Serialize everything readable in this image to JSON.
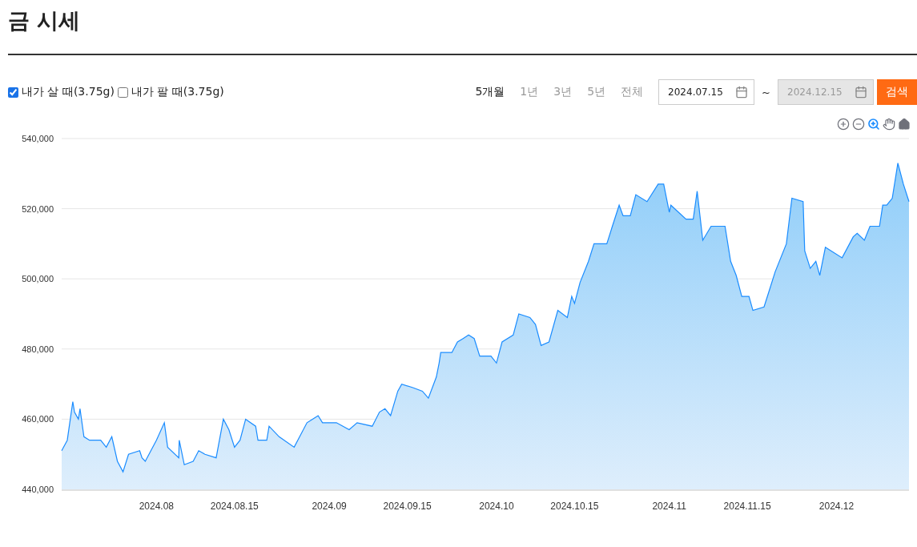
{
  "title": "금 시세",
  "options": [
    {
      "label": "내가 살 때(3.75g)",
      "checked": true
    },
    {
      "label": "내가 팔 때(3.75g)",
      "checked": false
    }
  ],
  "periods": [
    {
      "label": "5개월",
      "selected": true
    },
    {
      "label": "1년",
      "selected": false
    },
    {
      "label": "3년",
      "selected": false
    },
    {
      "label": "5년",
      "selected": false
    },
    {
      "label": "전체",
      "selected": false
    }
  ],
  "date_from": {
    "value": "2024.07.15",
    "disabled": false
  },
  "separator": "~",
  "date_to": {
    "value": "2024.12.15",
    "disabled": true
  },
  "search_button": "검색",
  "chart_tools": [
    {
      "kind": "zoom_in",
      "selected": false
    },
    {
      "kind": "zoom_out",
      "selected": false
    },
    {
      "kind": "selection_zoom",
      "selected": true
    },
    {
      "kind": "pan",
      "selected": false
    },
    {
      "kind": "reset",
      "selected": false
    }
  ],
  "chart_data": {
    "type": "area",
    "x": [
      "2024-07-15",
      "2024-07-16",
      "2024-07-17",
      "2024-07-17T07:00",
      "2024-07-18",
      "2024-07-18T07:00",
      "2024-07-19",
      "2024-07-20",
      "2024-07-22",
      "2024-07-23",
      "2024-07-24",
      "2024-07-25",
      "2024-07-26",
      "2024-07-27",
      "2024-07-29",
      "2024-07-29T10:00",
      "2024-07-30",
      "2024-07-31",
      "2024-08-01",
      "2024-08-02T10:00",
      "2024-08-03",
      "2024-08-05",
      "2024-08-05T02:00",
      "2024-08-06",
      "2024-08-07T14:00",
      "2024-08-08T14:00",
      "2024-08-09T17:00",
      "2024-08-11T17:00",
      "2024-08-13",
      "2024-08-14",
      "2024-08-15",
      "2024-08-16",
      "2024-08-17",
      "2024-08-18T19:00",
      "2024-08-19T05:00",
      "2024-08-20T19:00",
      "2024-08-21T05:00",
      "2024-08-23",
      "2024-08-25T17:00",
      "2024-08-28",
      "2024-08-29",
      "2024-08-30",
      "2024-08-30T19:00",
      "2024-09-02T07:00",
      "2024-09-04T14:00",
      "2024-09-06",
      "2024-09-08T17:00",
      "2024-09-10",
      "2024-09-11",
      "2024-09-12",
      "2024-09-13T07:00",
      "2024-09-14",
      "2024-09-16",
      "2024-09-17T17:00",
      "2024-09-18T19:00",
      "2024-09-20T05:00",
      "2024-09-20T17:00",
      "2024-09-21",
      "2024-09-23",
      "2024-09-24",
      "2024-09-25",
      "2024-09-26",
      "2024-09-27",
      "2024-09-28",
      "2024-09-30",
      "2024-10-01",
      "2024-10-02",
      "2024-10-04",
      "2024-10-05",
      "2024-10-07",
      "2024-10-08",
      "2024-10-09",
      "2024-10-10T10:00",
      "2024-10-12",
      "2024-10-13T17:00",
      "2024-10-14T12:00",
      "2024-10-15",
      "2024-10-16",
      "2024-10-17T12:00",
      "2024-10-18T12:00",
      "2024-10-20T19:00",
      "2024-10-21T19:00",
      "2024-10-23",
      "2024-10-23T17:00",
      "2024-10-25",
      "2024-10-26",
      "2024-10-28",
      "2024-10-30",
      "2024-10-31",
      "2024-11-01",
      "2024-11-01T07:00",
      "2024-11-04",
      "2024-11-05T07:00",
      "2024-11-06",
      "2024-11-07",
      "2024-11-08T12:00",
      "2024-11-11",
      "2024-11-12",
      "2024-11-13",
      "2024-11-14",
      "2024-11-15T07:00",
      "2024-11-16",
      "2024-11-18",
      "2024-11-19",
      "2024-11-20",
      "2024-11-22",
      "2024-11-23",
      "2024-11-25",
      "2024-11-25T07:00",
      "2024-11-26T07:00",
      "2024-11-27T07:00",
      "2024-11-28",
      "2024-11-29",
      "2024-12-02",
      "2024-12-04",
      "2024-12-04T17:00",
      "2024-12-06",
      "2024-12-07",
      "2024-12-08T17:00",
      "2024-12-09T07:00",
      "2024-12-10",
      "2024-12-11",
      "2024-12-12",
      "2024-12-13",
      "2024-12-14"
    ],
    "series": [
      {
        "color": "#1a8cff",
        "values": [
          451000,
          454000,
          465000,
          462000,
          460000,
          463000,
          455000,
          454000,
          454000,
          452000,
          455000,
          448000,
          445000,
          450000,
          451000,
          449000,
          448000,
          451000,
          454000,
          459000,
          452000,
          449000,
          454000,
          447000,
          448000,
          451000,
          450000,
          449000,
          460000,
          457000,
          452000,
          454000,
          460000,
          458000,
          454000,
          454000,
          458000,
          455000,
          452000,
          459000,
          460000,
          461000,
          459000,
          459000,
          457000,
          459000,
          458000,
          462000,
          463000,
          461000,
          468000,
          470000,
          469000,
          468000,
          466000,
          472000,
          476000,
          479000,
          479000,
          482000,
          483000,
          484000,
          483000,
          478000,
          478000,
          476000,
          482000,
          484000,
          490000,
          489000,
          487000,
          481000,
          482000,
          491000,
          489000,
          495000,
          493000,
          499000,
          505000,
          510000,
          510000,
          515000,
          521000,
          518000,
          518000,
          524000,
          522000,
          527000,
          527000,
          519000,
          521000,
          517000,
          517000,
          525000,
          511000,
          515000,
          515000,
          505000,
          501000,
          495000,
          495000,
          491000,
          492000,
          497000,
          502000,
          510000,
          523000,
          522000,
          508000,
          503000,
          505000,
          501000,
          509000,
          506000,
          512000,
          513000,
          511000,
          515000,
          515000,
          521000,
          521000,
          523000,
          533000,
          527000,
          522000
        ]
      }
    ],
    "xlim": [
      "2024-07-15",
      "2024-12-14"
    ],
    "ylim": [
      440000,
      540000
    ],
    "grid": true,
    "xticks": [
      {
        "value": "2024-08-01",
        "label": "2024.08"
      },
      {
        "value": "2024-08-15",
        "label": "2024.08.15"
      },
      {
        "value": "2024-09-01",
        "label": "2024.09"
      },
      {
        "value": "2024-09-15",
        "label": "2024.09.15"
      },
      {
        "value": "2024-10-01",
        "label": "2024.10"
      },
      {
        "value": "2024-10-15",
        "label": "2024.10.15"
      },
      {
        "value": "2024-11-01",
        "label": "2024.11"
      },
      {
        "value": "2024-11-15",
        "label": "2024.11.15"
      },
      {
        "value": "2024-12-01",
        "label": "2024.12"
      }
    ],
    "yticks": [
      {
        "value": 440000,
        "label": "440,000"
      },
      {
        "value": 460000,
        "label": "460,000"
      },
      {
        "value": 480000,
        "label": "480,000"
      },
      {
        "value": 500000,
        "label": "500,000"
      },
      {
        "value": 520000,
        "label": "520,000"
      },
      {
        "value": 540000,
        "label": "540,000"
      }
    ]
  }
}
